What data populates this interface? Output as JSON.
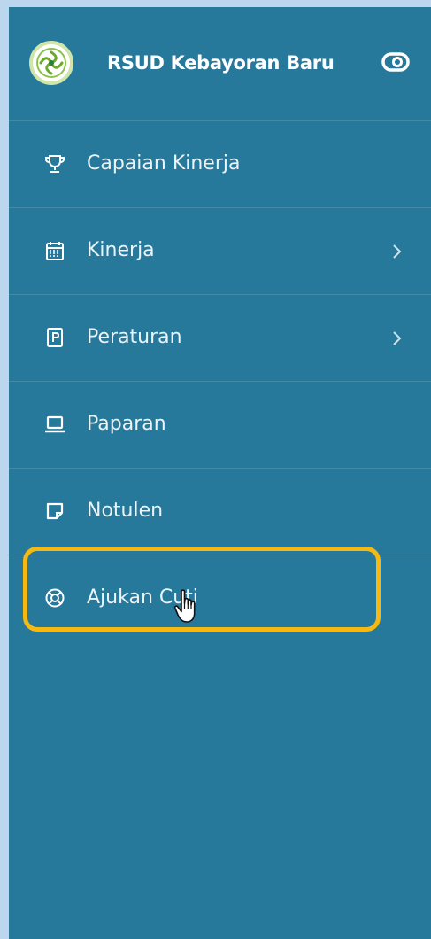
{
  "header": {
    "brand": "RSUD Kebayoran Baru",
    "logo_icon": "hospital-logo",
    "toggle_icon": "toggle-icon"
  },
  "menu": [
    {
      "label": "Capaian Kinerja",
      "icon": "trophy-icon",
      "has_submenu": false
    },
    {
      "label": "Kinerja",
      "icon": "calendar-icon",
      "has_submenu": true
    },
    {
      "label": "Peraturan",
      "icon": "document-p-icon",
      "has_submenu": true
    },
    {
      "label": "Paparan",
      "icon": "laptop-icon",
      "has_submenu": false
    },
    {
      "label": "Notulen",
      "icon": "sticky-note-icon",
      "has_submenu": false
    },
    {
      "label": "Ajukan Cuti",
      "icon": "lifebuoy-icon",
      "has_submenu": false
    }
  ],
  "colors": {
    "sidebar_bg": "#26799b",
    "page_bg": "#bcd6ee",
    "highlight": "#f6b911",
    "logo_ring": "#cfe5a9",
    "text": "#ffffff"
  }
}
